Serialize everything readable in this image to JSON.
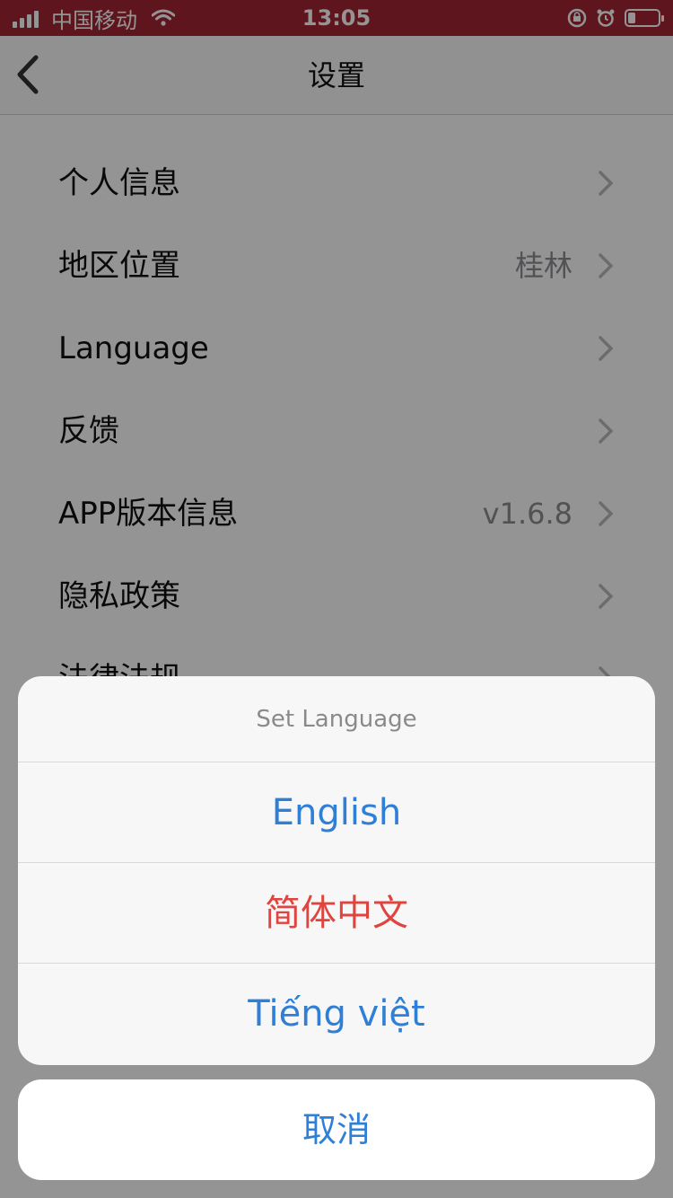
{
  "status_bar": {
    "carrier": "中国移动",
    "time": "13:05"
  },
  "nav": {
    "title": "设置"
  },
  "settings": {
    "items": [
      {
        "label": "个人信息",
        "value": ""
      },
      {
        "label": "地区位置",
        "value": "桂林"
      },
      {
        "label": "Language",
        "value": ""
      },
      {
        "label": "反馈",
        "value": ""
      },
      {
        "label": "APP版本信息",
        "value": "v1.6.8"
      },
      {
        "label": "隐私政策",
        "value": ""
      },
      {
        "label": "法律法规",
        "value": ""
      }
    ]
  },
  "action_sheet": {
    "title": "Set Language",
    "options": [
      {
        "label": "English",
        "selected": false
      },
      {
        "label": "简体中文",
        "selected": true
      },
      {
        "label": "Tiếng việt",
        "selected": false
      }
    ],
    "cancel_label": "取消"
  },
  "colors": {
    "status_bar_bg": "#a32533",
    "option_blue": "#2f7fd6",
    "option_selected_red": "#e0443e"
  }
}
